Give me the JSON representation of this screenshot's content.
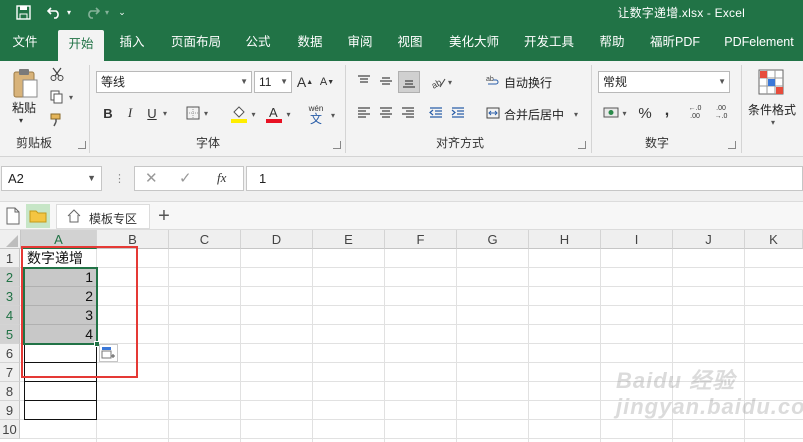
{
  "titlebar": {
    "title": "让数字递增.xlsx - Excel",
    "save_icon": "save-icon",
    "undo_icon": "undo-icon",
    "redo_icon": "redo-icon",
    "customize_icon": "customize-quick-access-icon"
  },
  "tabs": [
    {
      "label": "文件",
      "active": false
    },
    {
      "label": "开始",
      "active": true
    },
    {
      "label": "插入",
      "active": false
    },
    {
      "label": "页面布局",
      "active": false
    },
    {
      "label": "公式",
      "active": false
    },
    {
      "label": "数据",
      "active": false
    },
    {
      "label": "审阅",
      "active": false
    },
    {
      "label": "视图",
      "active": false
    },
    {
      "label": "美化大师",
      "active": false
    },
    {
      "label": "开发工具",
      "active": false
    },
    {
      "label": "帮助",
      "active": false
    },
    {
      "label": "福昕PDF",
      "active": false
    },
    {
      "label": "PDFelement",
      "active": false
    }
  ],
  "ribbon": {
    "clipboard": {
      "group_label": "剪贴板",
      "paste_label": "粘贴"
    },
    "font": {
      "group_label": "字体",
      "font_name": "等线",
      "font_size": "11",
      "grow_font": "A",
      "shrink_font": "A",
      "bold": "B",
      "italic": "I",
      "underline": "U",
      "font_color_letter": "A",
      "phonetic_top": "wén",
      "phonetic_bottom": "文",
      "font_color_hex": "#e81123",
      "highlight_hex": "#ffee00"
    },
    "alignment": {
      "group_label": "对齐方式",
      "wrap_text": "自动换行",
      "merge_center": "合并后居中"
    },
    "number": {
      "group_label": "数字",
      "format": "常规",
      "percent": "%",
      "comma": ",",
      "inc_decimal": "←.0 .00",
      "dec_decimal": ".00 →.0"
    },
    "styles": {
      "conditional_format": "条件格式"
    }
  },
  "formula_bar": {
    "name_box": "A2",
    "cancel": "✕",
    "enter": "✓",
    "fx": "fx",
    "value": "1"
  },
  "sheet_tabs": {
    "template_zone": "模板专区",
    "add": "+"
  },
  "grid": {
    "columns": [
      "A",
      "B",
      "C",
      "D",
      "E",
      "F",
      "G",
      "H",
      "I",
      "J",
      "K"
    ],
    "selected_column": "A",
    "rows": [
      "1",
      "2",
      "3",
      "4",
      "5",
      "6",
      "7",
      "8",
      "9",
      "10"
    ],
    "selected_rows": [
      "2",
      "3",
      "4",
      "5"
    ],
    "cells": {
      "A1": "数字递增",
      "A2": "1",
      "A3": "2",
      "A4": "3",
      "A5": "4"
    }
  },
  "colors": {
    "accent": "#217346",
    "highlight_box": "#e53935",
    "selection_fill": "#c8c8c8"
  },
  "watermark": "Baidu 经验 jingyan.baidu.com"
}
